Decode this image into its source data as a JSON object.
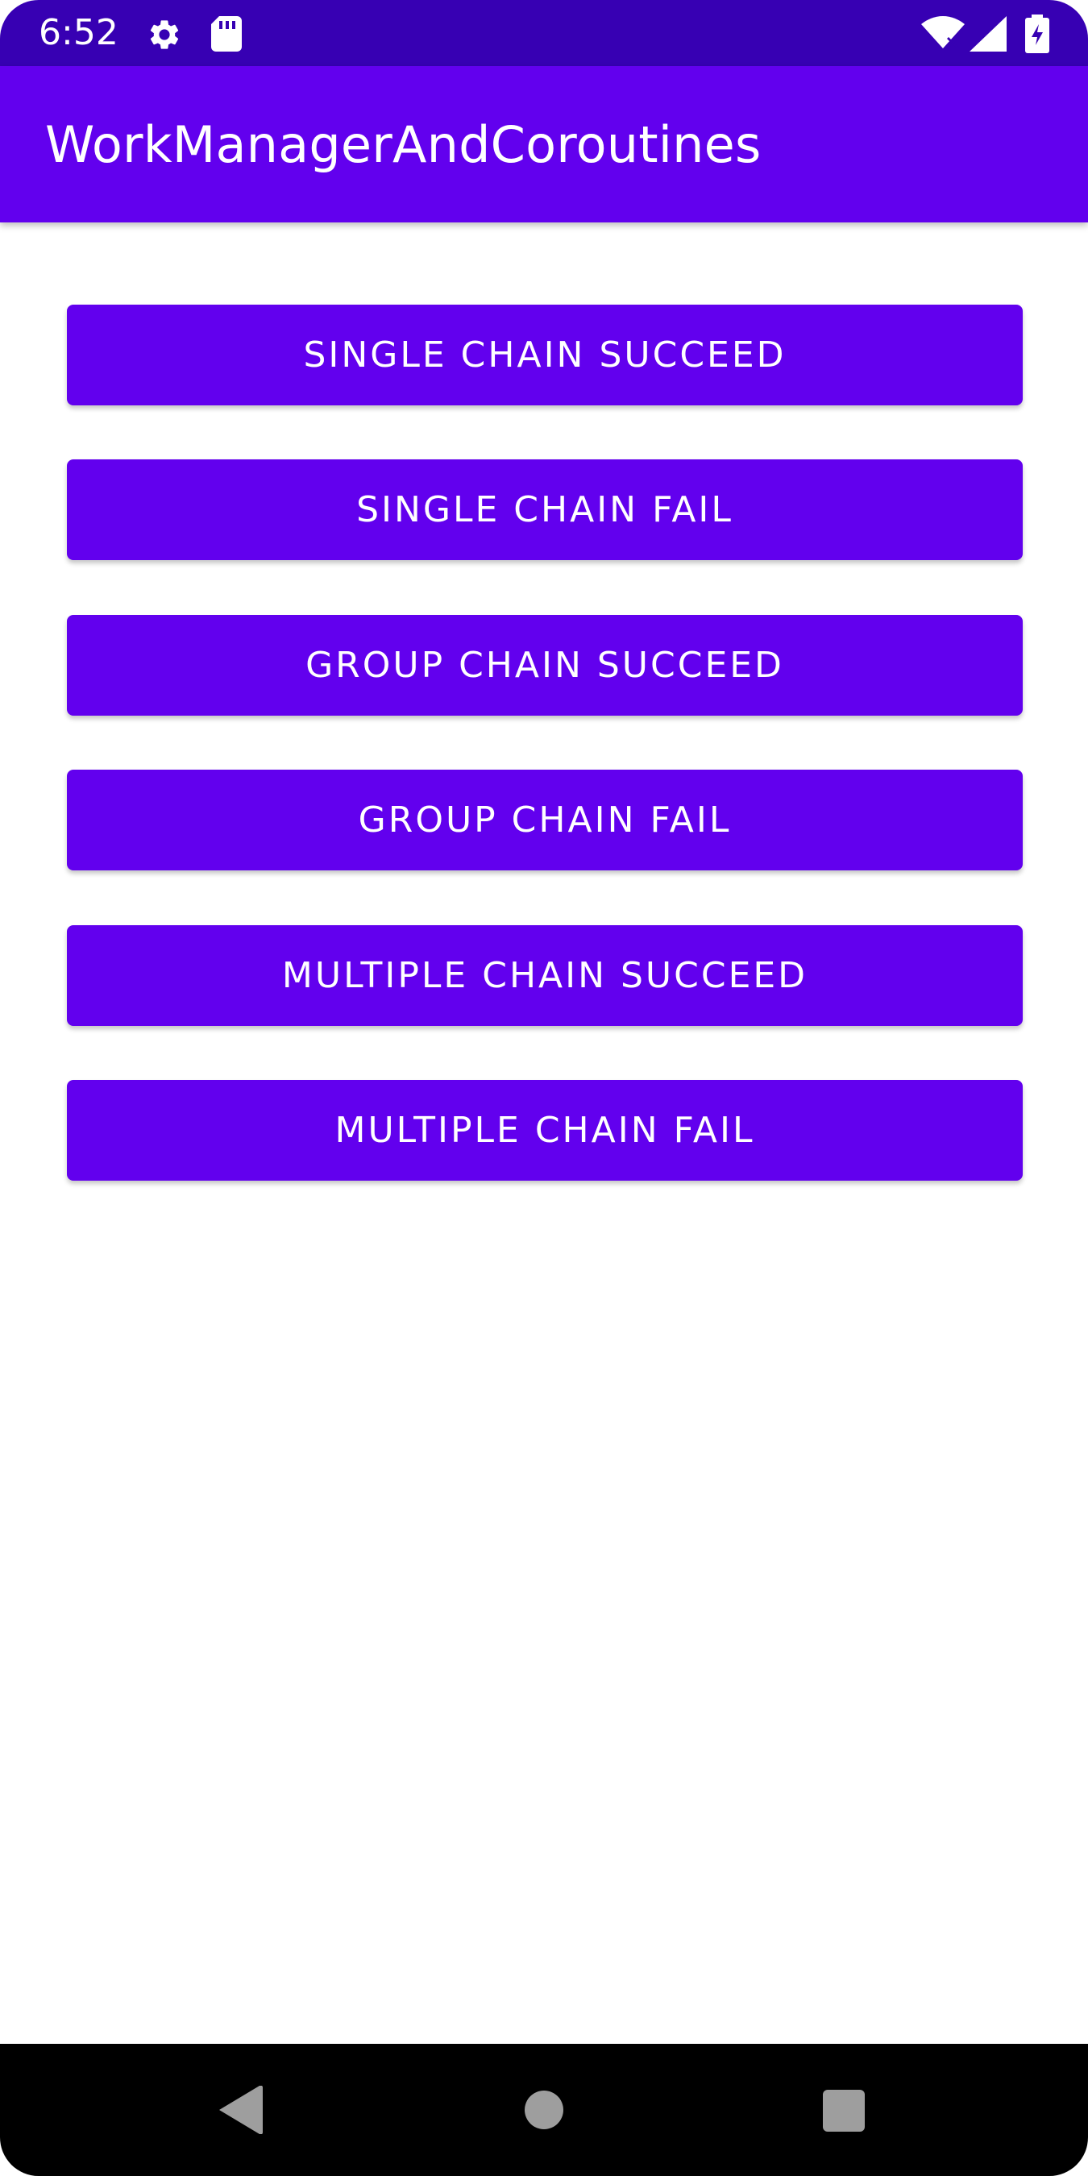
{
  "status_bar": {
    "time": "6:52",
    "icons": [
      "gear-icon",
      "sd-card-icon",
      "wifi-off-icon",
      "signal-icon",
      "battery-charging-icon"
    ],
    "background": "#3700b3"
  },
  "app_bar": {
    "title": "WorkManagerAndCoroutines",
    "background": "#6200ee"
  },
  "buttons": [
    {
      "label": "SINGLE CHAIN SUCCEED"
    },
    {
      "label": "SINGLE CHAIN FAIL"
    },
    {
      "label": "GROUP CHAIN SUCCEED"
    },
    {
      "label": "GROUP CHAIN FAIL"
    },
    {
      "label": "MULTIPLE CHAIN SUCCEED"
    },
    {
      "label": "MULTIPLE CHAIN FAIL"
    }
  ],
  "nav_bar": {
    "icons": [
      "back-icon",
      "home-icon",
      "recents-icon"
    ]
  },
  "colors": {
    "primary": "#6200ee",
    "primary_dark": "#3700b3",
    "on_primary": "#ffffff"
  }
}
